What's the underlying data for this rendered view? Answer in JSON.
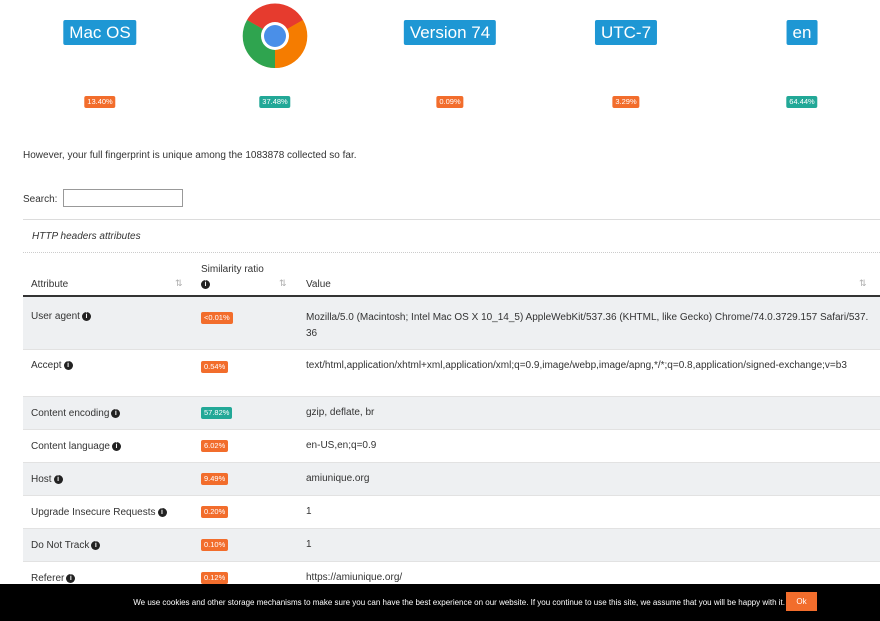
{
  "summary": [
    {
      "label": "Mac OS",
      "pct": "13.40%",
      "pct_color": "orange"
    },
    {
      "label": "",
      "icon": "chrome-icon",
      "pct": "37.48%",
      "pct_color": "green"
    },
    {
      "label": "Version 74",
      "pct": "0.09%",
      "pct_color": "orange"
    },
    {
      "label": "UTC-7",
      "pct": "3.29%",
      "pct_color": "orange"
    },
    {
      "label": "en",
      "pct": "64.44%",
      "pct_color": "green"
    }
  ],
  "unique_text": "However, your full fingerprint is unique among the 1083878 collected so far.",
  "search": {
    "label": "Search:",
    "value": ""
  },
  "section_title": "HTTP headers attributes",
  "table": {
    "headers": {
      "attribute": "Attribute",
      "similarity": "Similarity ratio",
      "value": "Value"
    },
    "rows": [
      {
        "attribute": "User agent",
        "ratio": "<0.01%",
        "ratio_color": "orange",
        "value": "Mozilla/5.0 (Macintosh; Intel Mac OS X 10_14_5) AppleWebKit/537.36 (KHTML, like Gecko) Chrome/74.0.3729.157 Safari/537.36"
      },
      {
        "attribute": "Accept",
        "ratio": "0.54%",
        "ratio_color": "orange",
        "value": "text/html,application/xhtml+xml,application/xml;q=0.9,image/webp,image/apng,*/*;q=0.8,application/signed-exchange;v=b3"
      },
      {
        "attribute": "Content encoding",
        "ratio": "57.82%",
        "ratio_color": "green",
        "value": "gzip, deflate, br"
      },
      {
        "attribute": "Content language",
        "ratio": "6.02%",
        "ratio_color": "orange",
        "value": "en-US,en;q=0.9"
      },
      {
        "attribute": "Host",
        "ratio": "9.49%",
        "ratio_color": "orange",
        "value": "amiunique.org"
      },
      {
        "attribute": "Upgrade Insecure Requests",
        "ratio": "0.20%",
        "ratio_color": "orange",
        "value": "1"
      },
      {
        "attribute": "Do Not Track",
        "ratio": "0.10%",
        "ratio_color": "orange",
        "value": "1"
      },
      {
        "attribute": "Referer",
        "ratio": "0.12%",
        "ratio_color": "orange",
        "value": "https://amiunique.org/"
      }
    ]
  },
  "cookie": {
    "message": "We use cookies and other storage mechanisms to make sure you can have the best experience on our website. If you continue to use this site, we assume that you will be happy with it.",
    "ok_label": "Ok"
  },
  "colors": {
    "blue": "#1e97d4",
    "orange": "#f26d2c",
    "green": "#22a897"
  }
}
